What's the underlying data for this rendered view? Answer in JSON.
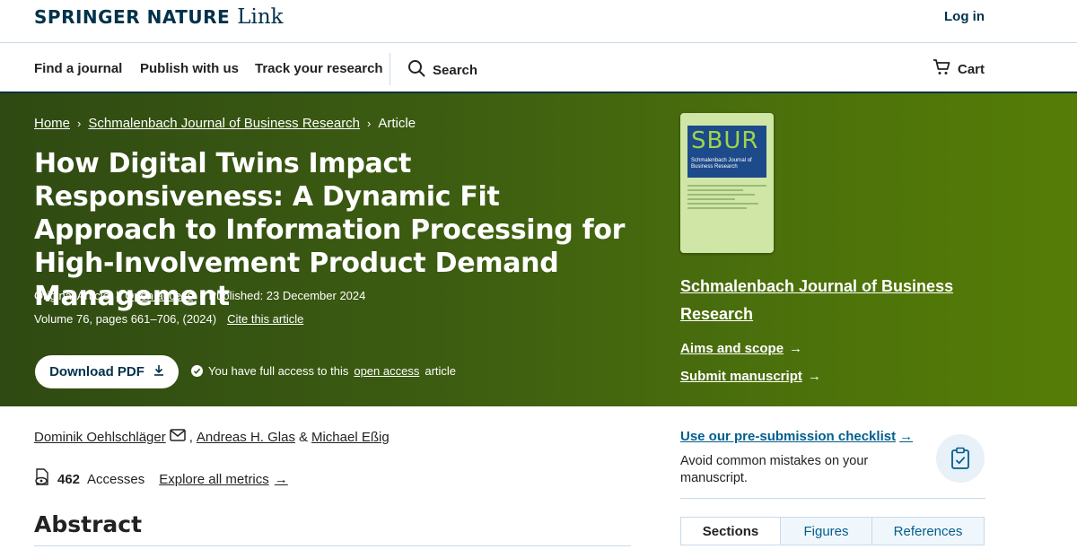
{
  "header": {
    "brand_primary": "SPRINGER NATURE",
    "brand_secondary": "Link",
    "login_label": "Log in"
  },
  "nav": {
    "items": [
      "Find a journal",
      "Publish with us",
      "Track your research"
    ],
    "search_label": "Search",
    "cart_label": "Cart"
  },
  "breadcrumb": {
    "home": "Home",
    "journal": "Schmalenbach Journal of Business Research",
    "current": "Article"
  },
  "article": {
    "title": "How Digital Twins Impact Responsiveness: A Dynamic Fit Approach to Information Processing for High-Involvement Product Demand Management",
    "type": "Original Article",
    "open_access": "Open access",
    "published": "Published: 23 December 2024",
    "volume": "Volume 76, pages 661–706, (2024)",
    "cite": "Cite this article",
    "download_label": "Download PDF",
    "access_prefix": "You have full access to this",
    "access_link": "open access",
    "access_suffix": "article"
  },
  "journal": {
    "cover_logo": "SBUR",
    "cover_subtitle": "Schmalenbach Journal of Business Research",
    "title": "Schmalenbach Journal of Business Research",
    "aims_label": "Aims and scope",
    "submit_label": "Submit manuscript"
  },
  "authors": {
    "list": [
      "Dominik Oehlschläger",
      "Andreas H. Glas",
      "Michael Eßig"
    ],
    "separator_amp": "&",
    "separator_comma": ","
  },
  "metrics": {
    "accesses_count": "462",
    "accesses_label": "Accesses",
    "explore_label": "Explore all metrics"
  },
  "abstract_heading": "Abstract",
  "sidebar": {
    "checklist_link": "Use our pre-submission checklist",
    "checklist_desc": "Avoid common mistakes on your manuscript.",
    "tabs": [
      "Sections",
      "Figures",
      "References"
    ]
  },
  "colors": {
    "brand_navy": "#01324b",
    "link_blue": "#025e8d",
    "hero_green": "#3c5c11"
  }
}
